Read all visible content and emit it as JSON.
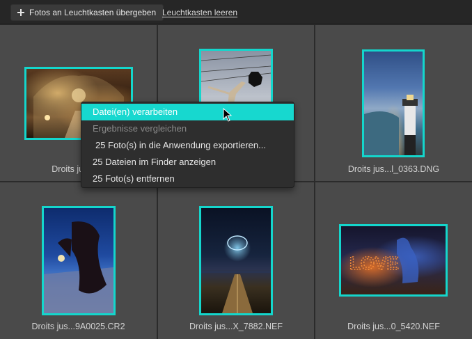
{
  "toolbar": {
    "add_button_label": "Fotos an Leuchtkasten übergeben",
    "add_icon": "plus-icon",
    "clear_link_label": "Leuchtkasten leeren"
  },
  "thumbnails": [
    {
      "caption": "Droits jusq...o",
      "icon": "image-opera-interior"
    },
    {
      "caption": "",
      "icon": "image-sky-figure"
    },
    {
      "caption": "Droits jus...l_0363.DNG",
      "icon": "image-lighthouse"
    },
    {
      "caption": "Droits jus...9A0025.CR2",
      "icon": "image-dancer"
    },
    {
      "caption": "Droits jus...X_7882.NEF",
      "icon": "image-night-pier"
    },
    {
      "caption": "Droits jus...0_5420.NEF",
      "icon": "image-love-lights"
    }
  ],
  "context_menu": {
    "items": [
      {
        "label": "Datei(en) verarbeiten",
        "state": "highlighted"
      },
      {
        "label": "Ergebnisse vergleichen",
        "state": "disabled"
      },
      {
        "label": "25 Foto(s) in die Anwendung exportieren...",
        "state": "normal"
      },
      {
        "label": "25 Dateien im Finder anzeigen",
        "state": "normal"
      },
      {
        "label": "25 Foto(s) entfernen",
        "state": "normal"
      }
    ]
  },
  "colors": {
    "accent": "#14d6cc",
    "menu_highlight": "#17d8cf",
    "cell_background": "#4a4a4a",
    "toolbar_background": "#262626"
  }
}
